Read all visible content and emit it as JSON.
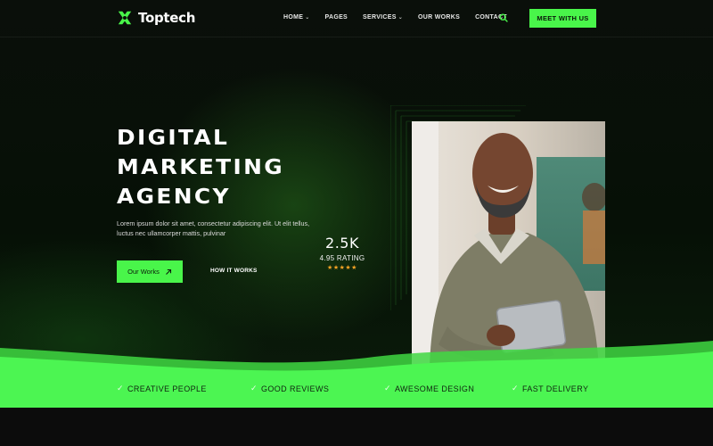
{
  "brand": {
    "name": "Toptech",
    "accent": "#49f54a",
    "logo_icon": "x-cross-logo-icon"
  },
  "nav": {
    "items": [
      {
        "label": "HOME",
        "dropdown": true
      },
      {
        "label": "PAGES",
        "dropdown": false
      },
      {
        "label": "SERVICES",
        "dropdown": true
      },
      {
        "label": "OUR WORKS",
        "dropdown": false
      },
      {
        "label": "CONTACT",
        "dropdown": false
      }
    ],
    "cta_label": "MEET WITH US"
  },
  "hero": {
    "title_lines": [
      "DIGITAL",
      "MARKETING",
      "AGENCY"
    ],
    "description": "Lorem ipsum dolor sit amet, consectetur adipiscing elit. Ut elit tellus, luctus nec ullamcorper mattis, pulvinar",
    "primary_button": "Our Works",
    "secondary_link": "HOW IT WORKS"
  },
  "rating": {
    "count": "2.5K",
    "label": "4.95 RATING",
    "stars": 5,
    "star_color": "#f4a324"
  },
  "features": [
    {
      "label": "CREATIVE PEOPLE"
    },
    {
      "label": "GOOD REVIEWS"
    },
    {
      "label": "AWESOME DESIGN"
    },
    {
      "label": "FAST DELIVERY"
    }
  ]
}
